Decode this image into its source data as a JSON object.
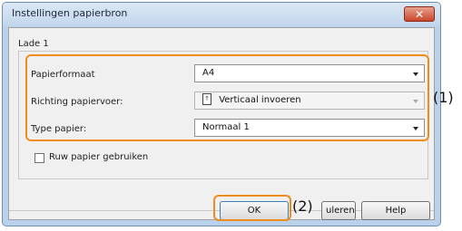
{
  "window": {
    "title": "Instellingen papierbron",
    "close_glyph": "✕"
  },
  "group": {
    "label": "Lade 1"
  },
  "fields": [
    {
      "label": "Papierformaat",
      "value": "A4"
    },
    {
      "label": "Richting papiervoer:",
      "value": "Verticaal invoeren",
      "icon": "paper-feed-icon"
    },
    {
      "label": "Type papier:",
      "value": "Normaal 1"
    }
  ],
  "checkbox": {
    "label": "Ruw papier gebruiken",
    "checked": false
  },
  "buttons": {
    "ok": "OK",
    "cancel": "Annuleren",
    "cancel_visible": "uleren",
    "help": "Help"
  },
  "callouts": {
    "one": "(1)",
    "two": "(2)"
  },
  "colors": {
    "highlight": "#f08c1e",
    "titlebar": "#c2d6ec"
  }
}
